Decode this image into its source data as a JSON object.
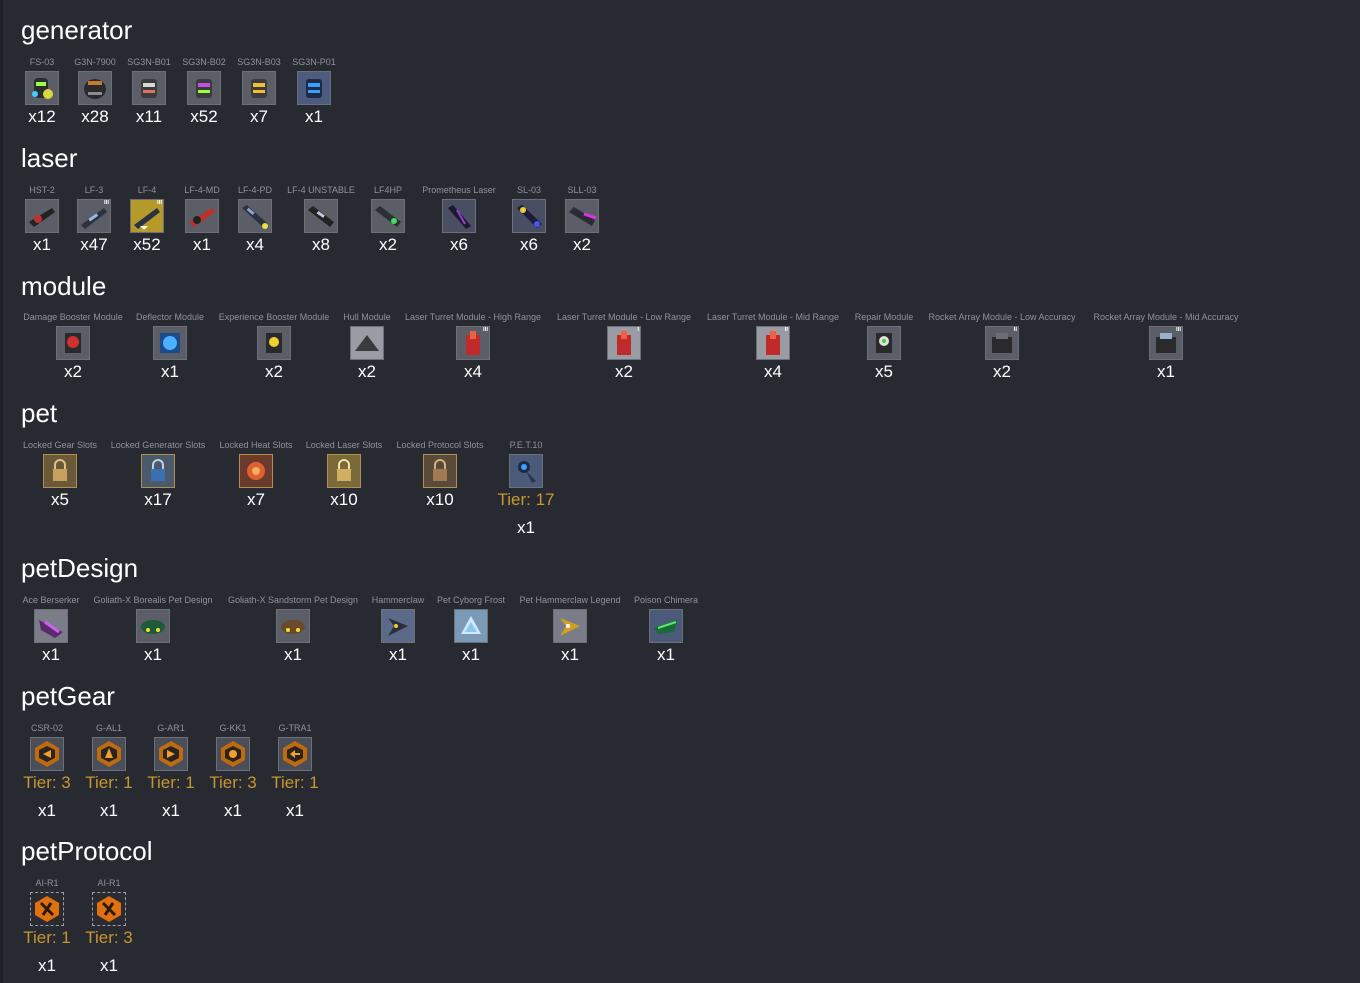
{
  "sections": {
    "generator": {
      "title": "generator",
      "items": [
        {
          "name": "FS-03",
          "count": "x12"
        },
        {
          "name": "G3N-7900",
          "count": "x28"
        },
        {
          "name": "SG3N-B01",
          "count": "x11"
        },
        {
          "name": "SG3N-B02",
          "count": "x52"
        },
        {
          "name": "SG3N-B03",
          "count": "x7"
        },
        {
          "name": "SG3N-P01",
          "count": "x1"
        }
      ]
    },
    "laser": {
      "title": "laser",
      "items": [
        {
          "name": "HST-2",
          "count": "x1"
        },
        {
          "name": "LF-3",
          "count": "x47"
        },
        {
          "name": "LF-4",
          "count": "x52"
        },
        {
          "name": "LF-4-MD",
          "count": "x1"
        },
        {
          "name": "LF-4-PD",
          "count": "x4"
        },
        {
          "name": "LF-4 UNSTABLE",
          "count": "x8"
        },
        {
          "name": "LF4HP",
          "count": "x2"
        },
        {
          "name": "Prometheus Laser",
          "count": "x6"
        },
        {
          "name": "SL-03",
          "count": "x6"
        },
        {
          "name": "SLL-03",
          "count": "x2"
        }
      ]
    },
    "module": {
      "title": "module",
      "items": [
        {
          "name": "Damage Booster Module",
          "count": "x2"
        },
        {
          "name": "Deflector Module",
          "count": "x1"
        },
        {
          "name": "Experience Booster Module",
          "count": "x2"
        },
        {
          "name": "Hull Module",
          "count": "x2"
        },
        {
          "name": "Laser Turret Module - High Range",
          "count": "x4"
        },
        {
          "name": "Laser Turret Module - Low Range",
          "count": "x2"
        },
        {
          "name": "Laser Turret Module - Mid Range",
          "count": "x4"
        },
        {
          "name": "Repair Module",
          "count": "x5"
        },
        {
          "name": "Rocket Array Module - Low Accuracy",
          "count": "x2"
        },
        {
          "name": "Rocket Array Module - Mid Accuracy",
          "count": "x1"
        }
      ]
    },
    "pet": {
      "title": "pet",
      "items": [
        {
          "name": "Locked Gear Slots",
          "count": "x5"
        },
        {
          "name": "Locked Generator Slots",
          "count": "x17"
        },
        {
          "name": "Locked Heat Slots",
          "count": "x7"
        },
        {
          "name": "Locked Laser Slots",
          "count": "x10"
        },
        {
          "name": "Locked Protocol Slots",
          "count": "x10"
        },
        {
          "name": "P.E.T.10",
          "tier": "Tier: 17",
          "count": "x1"
        }
      ]
    },
    "petDesign": {
      "title": "petDesign",
      "items": [
        {
          "name": "Ace Berserker",
          "count": "x1"
        },
        {
          "name": "Goliath-X Borealis Pet Design",
          "count": "x1"
        },
        {
          "name": "Goliath-X Sandstorm Pet Design",
          "count": "x1"
        },
        {
          "name": "Hammerclaw",
          "count": "x1"
        },
        {
          "name": "Pet Cyborg Frost",
          "count": "x1"
        },
        {
          "name": "Pet Hammerclaw Legend",
          "count": "x1"
        },
        {
          "name": "Poison Chimera",
          "count": "x1"
        }
      ]
    },
    "petGear": {
      "title": "petGear",
      "items": [
        {
          "name": "CSR-02",
          "tier": "Tier: 3",
          "count": "x1"
        },
        {
          "name": "G-AL1",
          "tier": "Tier: 1",
          "count": "x1"
        },
        {
          "name": "G-AR1",
          "tier": "Tier: 1",
          "count": "x1"
        },
        {
          "name": "G-KK1",
          "tier": "Tier: 3",
          "count": "x1"
        },
        {
          "name": "G-TRA1",
          "tier": "Tier: 1",
          "count": "x1"
        }
      ]
    },
    "petProtocol": {
      "title": "petProtocol",
      "items": [
        {
          "name": "AI-R1",
          "tier": "Tier: 1",
          "count": "x1"
        },
        {
          "name": "AI-R1",
          "tier": "Tier: 3",
          "count": "x1"
        }
      ]
    }
  },
  "badges": {
    "laser_lf3": "III",
    "laser_lf4": "III",
    "module_high": "III",
    "module_low": "I",
    "module_mid": "II",
    "module_rocket_low": "II",
    "module_rocket_mid": "III"
  },
  "colors": {
    "background": "#282a32",
    "text": "#ffffff",
    "label": "#8f929b",
    "tier": "#c9962d"
  }
}
